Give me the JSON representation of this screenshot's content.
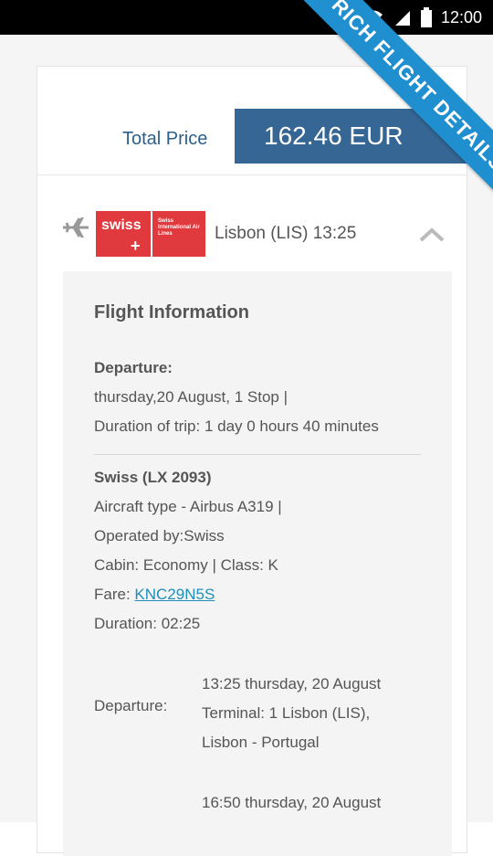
{
  "status_bar": {
    "time": "12:00"
  },
  "ribbon": {
    "text": "RICH FLIGHT DETAILS"
  },
  "price": {
    "label": "Total Price",
    "value": "162.46 EUR"
  },
  "flight": {
    "airline_logo_word": "swiss",
    "airline_logo_fine": "Swiss International Air Lines",
    "route_text": "Lisbon (LIS)  13:25"
  },
  "info": {
    "title": "Flight Information",
    "departure_heading": "Departure:",
    "departure_line1": "thursday,20 August, 1 Stop |",
    "departure_line2": "Duration of trip: 1 day 0 hours 40 minutes",
    "segment_title": "Swiss (LX 2093)",
    "aircraft": "Aircraft type - Airbus A319 |",
    "operated": "Operated by:Swiss",
    "cabin": "Cabin: Economy | Class: K",
    "fare_label": "Fare: ",
    "fare_code": "KNC29N5S",
    "duration": "Duration: 02:25",
    "dep_label": "Departure:",
    "dep_line1": "13:25 thursday, 20 August",
    "dep_line2": "Terminal: 1 Lisbon (LIS),",
    "dep_line3": "Lisbon - Portugal",
    "arr_line1": "16:50 thursday, 20 August"
  },
  "colors": {
    "price_box": "#356694",
    "ribbon": "#1f8fd0",
    "logo": "#e0393e",
    "link": "#1f8fb8"
  },
  "icons": [
    "wifi-icon",
    "signal-icon",
    "battery-icon",
    "plane-icon",
    "chevron-up-icon"
  ]
}
